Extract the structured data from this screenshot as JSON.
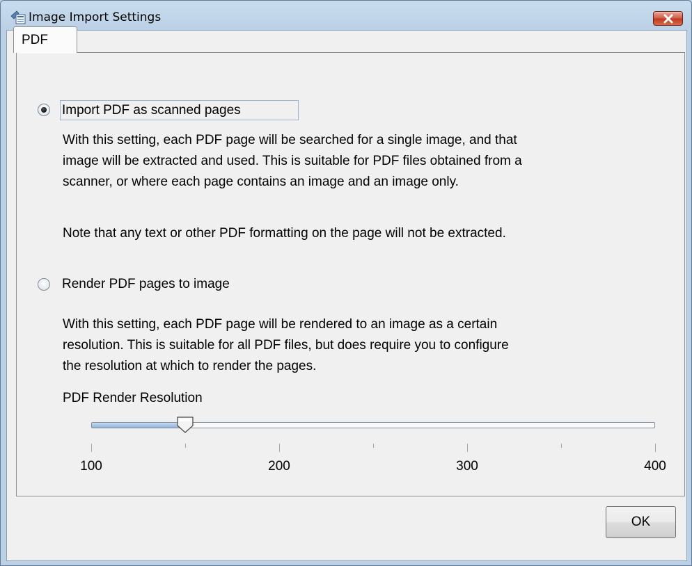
{
  "window": {
    "title": "Image Import Settings"
  },
  "tabs": [
    {
      "label": "PDF",
      "selected": true
    }
  ],
  "options": {
    "scanned": {
      "label": "Import PDF as scanned pages",
      "selected": true,
      "description": [
        "With this setting, each PDF page will be searched for a single image, and that",
        "image will be extracted and used. This is suitable for PDF files obtained from a",
        "scanner, or where each page contains an image and an image only."
      ],
      "note": "Note that any text or other PDF formatting on the page will not be extracted."
    },
    "render": {
      "label": "Render PDF pages to image",
      "selected": false,
      "description": [
        "With this setting, each PDF page will be rendered to an image as a certain",
        "resolution. This is suitable for all PDF files, but does require you to configure",
        "the resolution at which to render the pages."
      ]
    }
  },
  "resolution": {
    "label": "PDF Render Resolution",
    "min": 100,
    "max": 400,
    "value": 150,
    "tick_labels": [
      "100",
      "200",
      "300",
      "400"
    ]
  },
  "buttons": {
    "ok": "OK"
  },
  "colors": {
    "title_bar": "#bcd1e6",
    "close_button": "#c9442e",
    "dialog_bg": "#f0f0f0"
  },
  "icons": {
    "app": "image-settings-icon",
    "close": "close-icon"
  }
}
